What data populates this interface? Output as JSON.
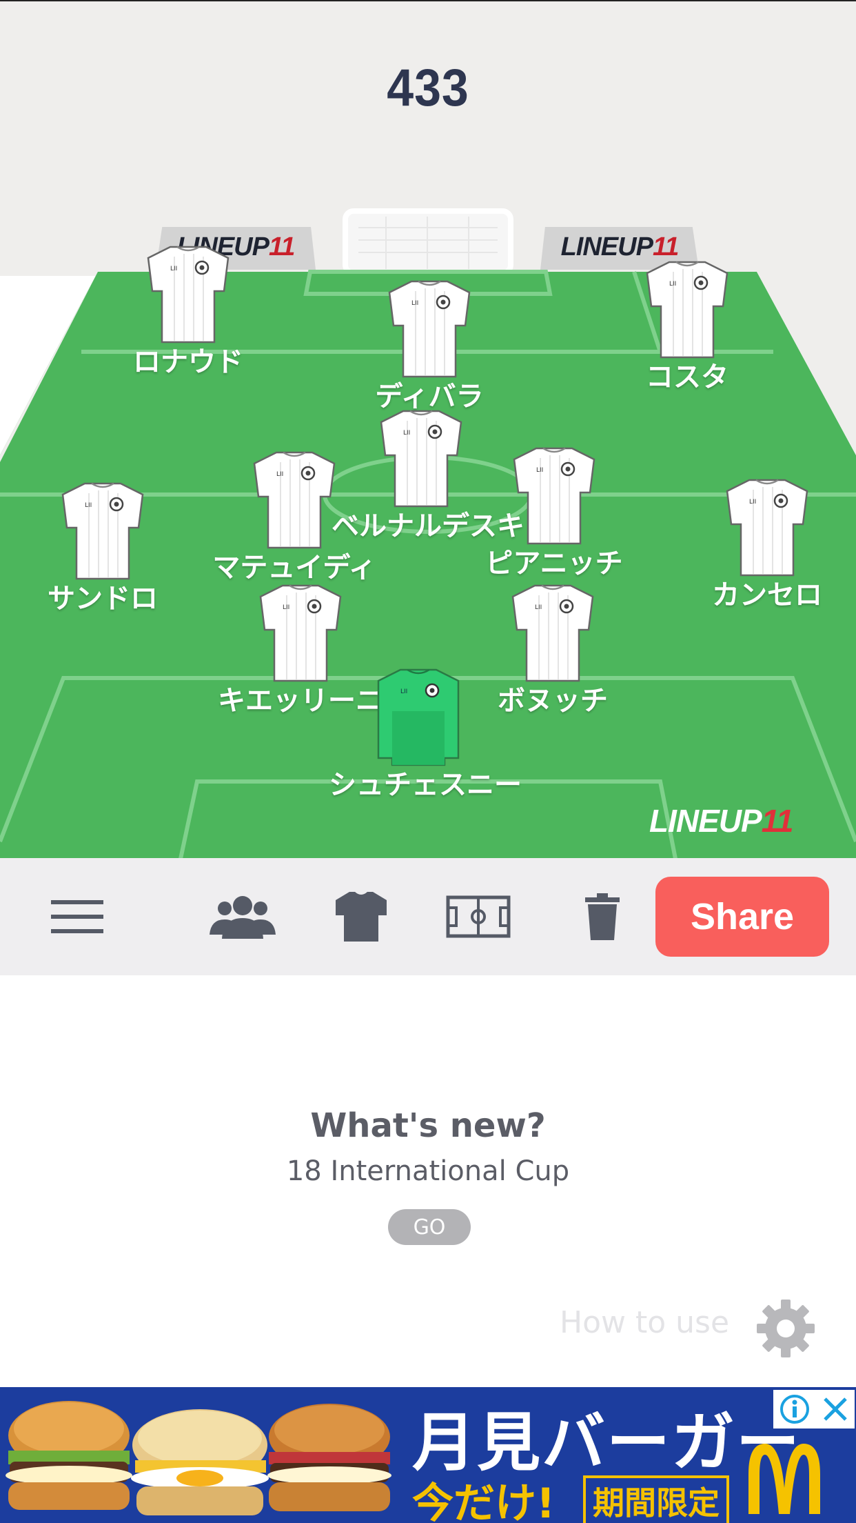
{
  "formation": "433",
  "boards": {
    "left_text": "LINEUP",
    "left_num": "11",
    "right_text": "LINEUP",
    "right_num": "11"
  },
  "pitch_logo": {
    "text": "LINEUP",
    "num": "11"
  },
  "players": [
    {
      "id": "ronaldo",
      "name": "ロナウド",
      "kit": "white"
    },
    {
      "id": "dybala",
      "name": "ディバラ",
      "kit": "white"
    },
    {
      "id": "costa",
      "name": "コスタ",
      "kit": "white"
    },
    {
      "id": "bernardeschi",
      "name": "ベルナルデスキ",
      "kit": "white"
    },
    {
      "id": "matuidi",
      "name": "マテュイディ",
      "kit": "white"
    },
    {
      "id": "pjanic",
      "name": "ピアニッチ",
      "kit": "white"
    },
    {
      "id": "sandro",
      "name": "サンドロ",
      "kit": "white"
    },
    {
      "id": "cancelo",
      "name": "カンセロ",
      "kit": "white"
    },
    {
      "id": "chiellini",
      "name": "キエッリーニ",
      "kit": "white"
    },
    {
      "id": "bonucci",
      "name": "ボヌッチ",
      "kit": "white"
    },
    {
      "id": "szczesny",
      "name": "シュチェスニー",
      "kit": "goalkeeper"
    }
  ],
  "toolbar": {
    "icons": [
      "menu-icon",
      "players-icon",
      "shirt-icon",
      "pitch-icon",
      "trash-icon"
    ],
    "share_label": "Share"
  },
  "whats_new": {
    "title": "What's new?",
    "subtitle": "18 International Cup",
    "go_label": "GO"
  },
  "how_to_use": "How to use",
  "ad": {
    "title": "月見バーガー",
    "sub": "今だけ!",
    "badge": "期間限定"
  },
  "colors": {
    "pitch": "#4cb65c",
    "share": "#f95f5c",
    "formation": "#2e3650",
    "ad_bg": "#1c3d9e"
  }
}
